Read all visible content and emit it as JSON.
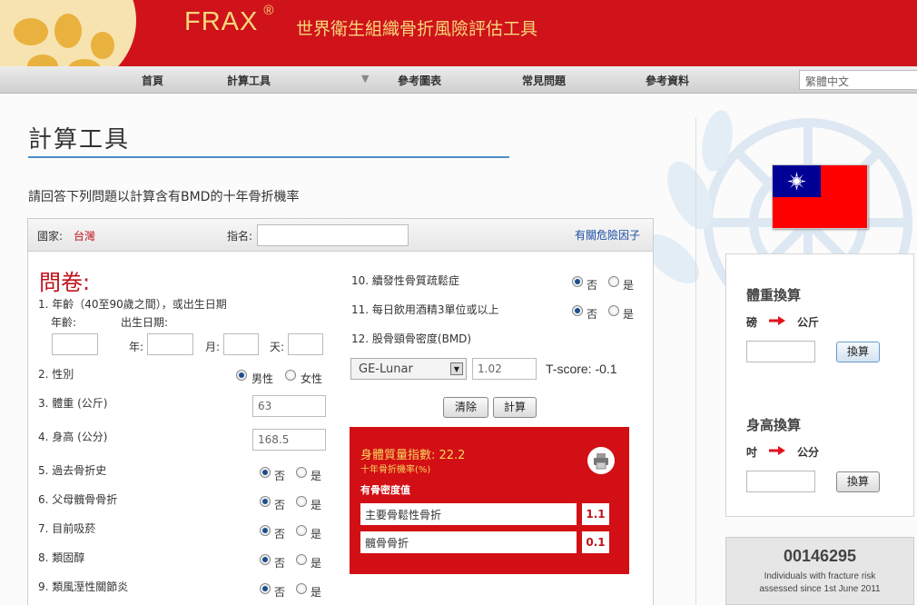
{
  "header": {
    "brand": "FRAX",
    "brand_mark": "®",
    "subtitle": "世界衛生組織骨折風險評估工具"
  },
  "nav": {
    "items": [
      "首頁",
      "計算工具",
      "參考圖表",
      "常見問題",
      "參考資料"
    ],
    "language": "繁體中文"
  },
  "page": {
    "title": "計算工具",
    "intro": "請回答下列問題以計算含有BMD的十年骨折機率"
  },
  "form": {
    "country_label": "國家:",
    "country_value": "台灣",
    "name_label": "指名:",
    "risk_link": "有關危險因子",
    "questionnaire_title": "問卷:",
    "q1": "1. 年齡（40至90歲之間），或出生日期",
    "age_label": "年齡:",
    "dob_label": "出生日期:",
    "year_label": "年:",
    "month_label": "月:",
    "day_label": "天:",
    "q2": "2. 性別",
    "male": "男性",
    "female": "女性",
    "q3": "3. 體重 (公斤)",
    "weight": "63",
    "q4": "4. 身高 (公分)",
    "height": "168.5",
    "q5": "5. 過去骨折史",
    "q6": "6. 父母髖骨骨折",
    "q7": "7. 目前吸菸",
    "q8": "8. 類固醇",
    "q9": "9. 類風溼性關節炎",
    "q10": "10. 續發性骨質疏鬆症",
    "q11": "11. 每日飲用酒精3單位或以上",
    "q12": "12. 股骨頸骨密度(BMD)",
    "no": "否",
    "yes": "是",
    "bmd_device": "GE-Lunar",
    "bmd_value": "1.02",
    "tscore": "T-score: -0.1",
    "clear_button": "清除",
    "calc_button": "計算"
  },
  "result": {
    "bmi": "身體質量指數: 22.2",
    "ten_year": "十年骨折機率(%)",
    "bmd_heading": "有骨密度值",
    "rows": [
      {
        "label": "主要骨鬆性骨折",
        "value": "1.1"
      },
      {
        "label": "髖骨骨折",
        "value": "0.1"
      }
    ]
  },
  "converters": {
    "weight_title": "體重換算",
    "weight_from": "磅",
    "weight_to": "公斤",
    "height_title": "身高換算",
    "height_from": "吋",
    "height_to": "公分",
    "convert_button": "換算"
  },
  "counter": {
    "number": "00146295",
    "line1": "Individuals with fracture risk",
    "line2": "assessed since 1st June 2011"
  },
  "colors": {
    "header_red": "#d0121b",
    "brand_gold": "#f5d77a",
    "rule_blue": "#4d8ec5",
    "result_red": "#d20f14",
    "flag_red": "#fe0000",
    "flag_blue": "#000095"
  }
}
